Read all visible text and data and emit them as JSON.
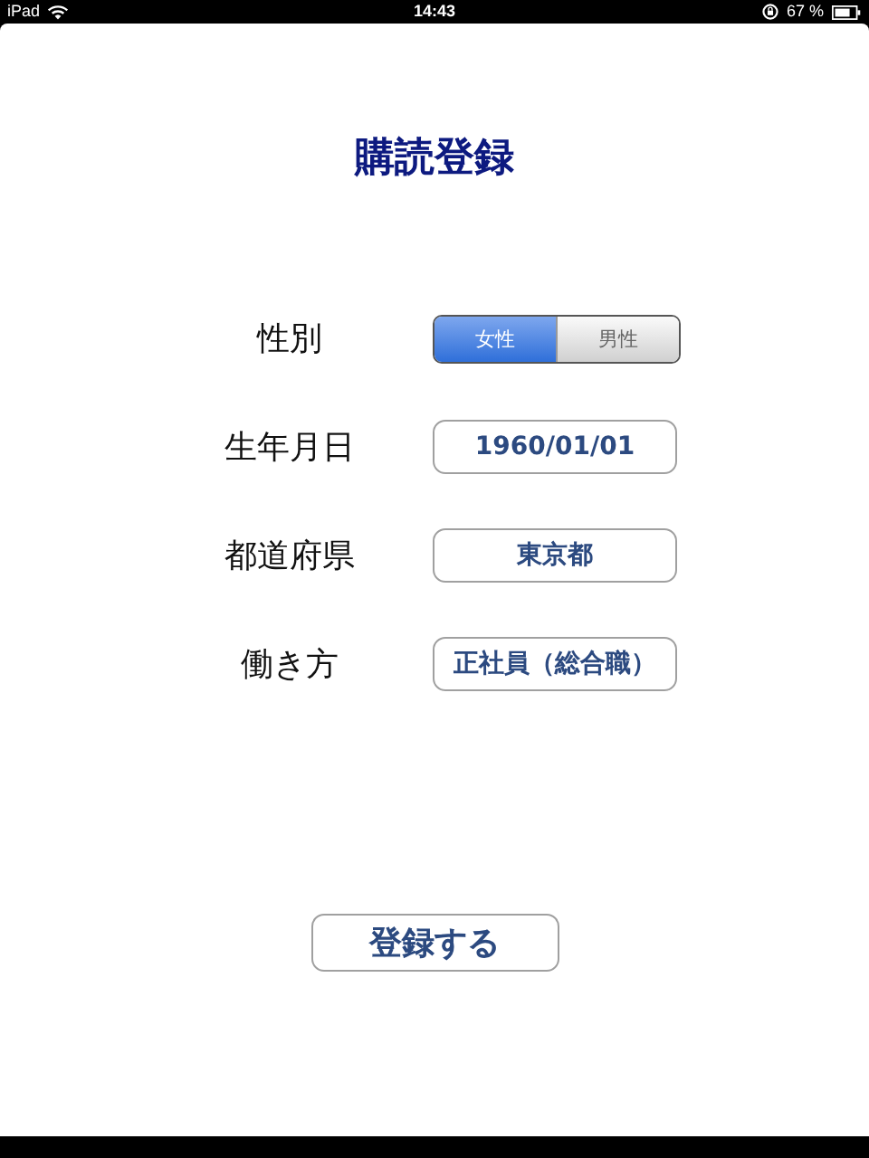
{
  "status_bar": {
    "device": "iPad",
    "time": "14:43",
    "battery": "67 %"
  },
  "title": "購読登録",
  "fields": [
    {
      "kind": "segmented",
      "label": "性別",
      "segments": [
        {
          "label": "女性",
          "selected": true
        },
        {
          "label": "男性",
          "selected": false
        }
      ]
    },
    {
      "kind": "value",
      "label": "生年月日",
      "value": "1960/01/01"
    },
    {
      "kind": "value",
      "label": "都道府県",
      "value": "東京都"
    },
    {
      "kind": "value",
      "label": "働き方",
      "value": "正社員（総合職）"
    }
  ],
  "submit": "登録する"
}
